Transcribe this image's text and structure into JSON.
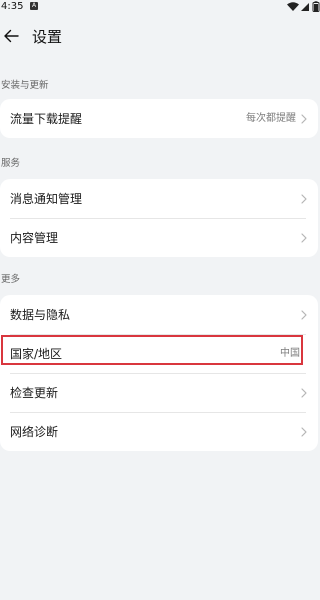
{
  "status_bar": {
    "time": "4:35",
    "notification_icon": "notification-a-icon",
    "wifi_icon": "wifi-icon",
    "signal_icon": "signal-icon",
    "battery_icon": "battery-icon"
  },
  "header": {
    "back_icon": "arrow-left-icon",
    "title": "设置"
  },
  "sections": [
    {
      "label": "安装与更新",
      "items": [
        {
          "label": "流量下载提醒",
          "value": "每次都提醒"
        }
      ]
    },
    {
      "label": "服务",
      "items": [
        {
          "label": "消息通知管理",
          "value": ""
        },
        {
          "label": "内容管理",
          "value": ""
        }
      ]
    },
    {
      "label": "更多",
      "items": [
        {
          "label": "数据与隐私",
          "value": ""
        },
        {
          "label": "国家/地区",
          "value": "中国"
        },
        {
          "label": "检查更新",
          "value": ""
        },
        {
          "label": "网络诊断",
          "value": ""
        }
      ]
    }
  ],
  "colors": {
    "background": "#f1f3f5",
    "card": "#ffffff",
    "highlight": "#d9363e",
    "secondary_text": "#7d7d7d"
  }
}
